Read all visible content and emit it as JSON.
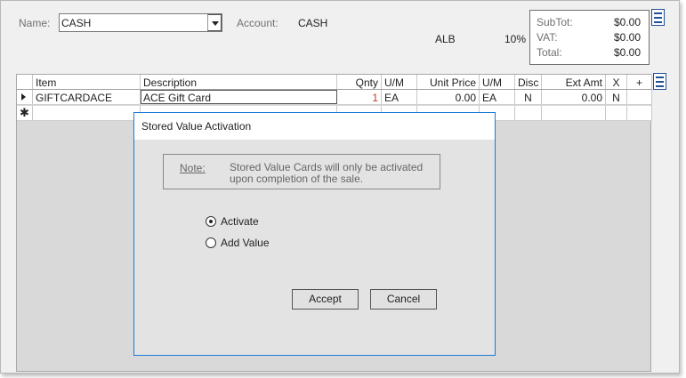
{
  "header": {
    "name_label": "Name:",
    "name_value": "CASH",
    "account_label": "Account:",
    "account_value": "CASH",
    "store_code": "ALB",
    "vat_rate": "10%"
  },
  "totals": {
    "subtotal_label": "SubTot:",
    "subtotal_value": "$0.00",
    "vat_label": "VAT:",
    "vat_value": "$0.00",
    "total_label": "Total:",
    "total_value": "$0.00"
  },
  "grid": {
    "columns": [
      "Item",
      "Description",
      "Qnty",
      "U/M",
      "Unit Price",
      "U/M",
      "Disc",
      "Ext Amt",
      "X",
      "+"
    ],
    "row": {
      "item": "GIFTCARDACE",
      "description": "ACE Gift Card",
      "qnty": "1",
      "um": "EA",
      "unit_price": "0.00",
      "um2": "EA",
      "disc": "N",
      "ext_amt": "0.00",
      "x": "N"
    },
    "new_row_marker": "✱"
  },
  "dialog": {
    "title": "Stored Value Activation",
    "note_label": "Note:",
    "note_text": "Stored Value Cards will only be activated upon completion of the sale.",
    "options": [
      {
        "label": "Activate",
        "selected": true
      },
      {
        "label": "Add Value",
        "selected": false
      }
    ],
    "accept_label": "Accept",
    "cancel_label": "Cancel"
  },
  "icons": {
    "totals_menu": "menu-icon",
    "grid_menu": "menu-icon"
  },
  "colors": {
    "accent": "#1f4e9a",
    "dialog_border": "#1c7ad6"
  }
}
